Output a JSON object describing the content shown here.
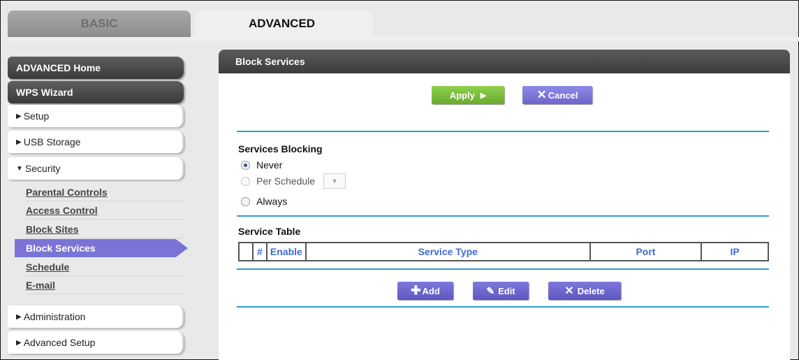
{
  "tabs": {
    "basic": "BASIC",
    "advanced": "ADVANCED"
  },
  "sidebar": {
    "advanced_home": "ADVANCED Home",
    "wps_wizard": "WPS Wizard",
    "setup": "Setup",
    "usb_storage": "USB Storage",
    "security": "Security",
    "security_items": [
      "Parental Controls",
      "Access Control",
      "Block Sites",
      "Block Services",
      "Schedule",
      "E-mail"
    ],
    "active_item": "Block Services",
    "administration": "Administration",
    "advanced_setup": "Advanced Setup"
  },
  "panel": {
    "title": "Block Services",
    "apply_label": "Apply",
    "cancel_label": "Cancel",
    "services_blocking": {
      "heading": "Services Blocking",
      "options": [
        "Never",
        "Per Schedule",
        "Always"
      ],
      "selected": "Never"
    },
    "service_table": {
      "heading": "Service Table",
      "columns": [
        "#",
        "Enable",
        "Service Type",
        "Port",
        "IP"
      ],
      "rows": []
    },
    "add_label": "Add",
    "edit_label": "Edit",
    "delete_label": "Delete"
  },
  "colors": {
    "accent_purple": "#7b73d6",
    "apply_green": "#7cbf3e",
    "rule_blue": "#2e9fcf",
    "header_dark": "#4a4a4a",
    "table_header_text": "#3d6bd6"
  },
  "icons": {
    "apply": "triangle-right-icon",
    "cancel": "x-icon",
    "add": "plus-icon",
    "edit": "pencil-icon",
    "delete": "x-icon",
    "nav": "triangle-right-icon",
    "nav_open": "triangle-down-icon"
  }
}
